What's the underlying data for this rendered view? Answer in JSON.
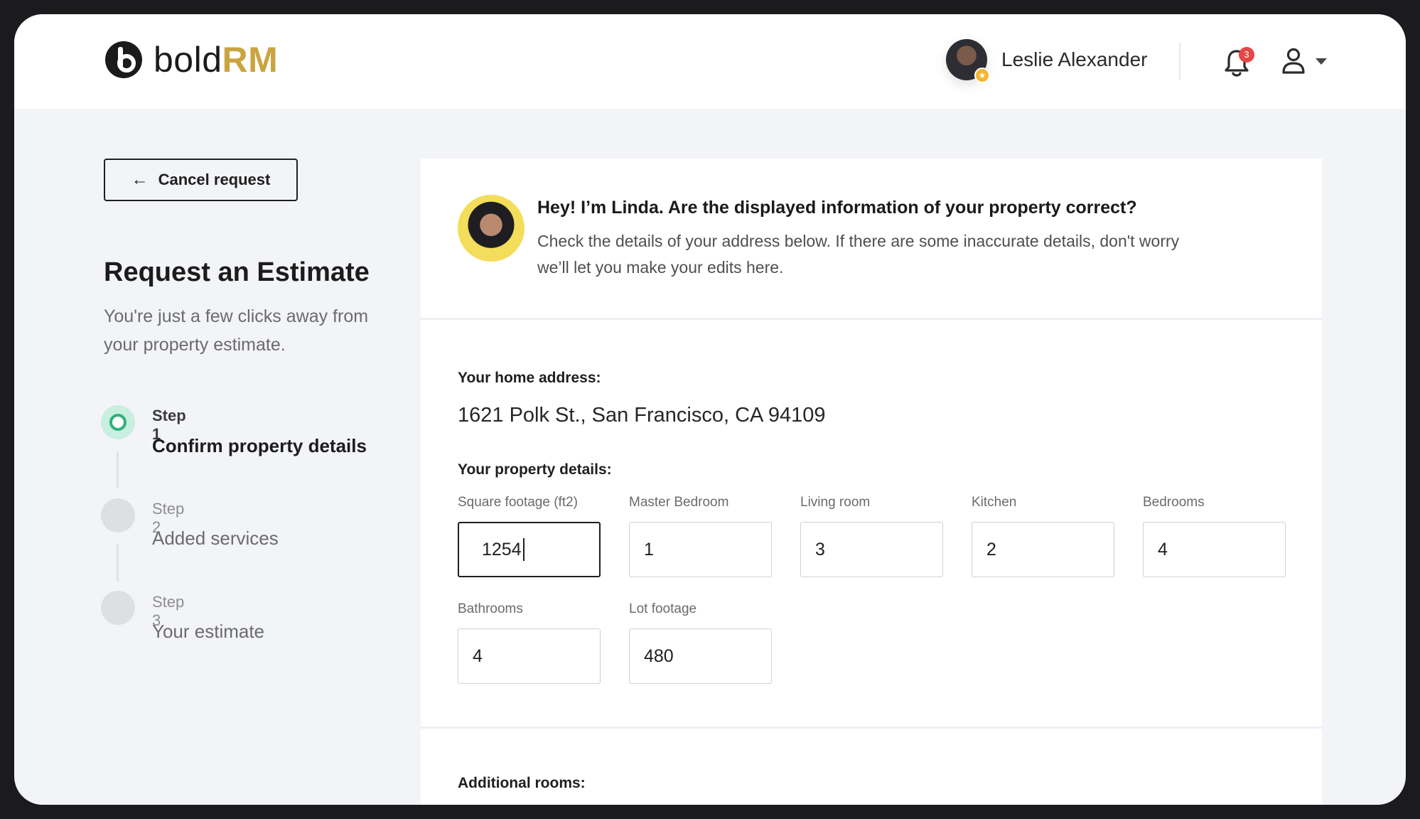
{
  "header": {
    "logo": {
      "text_main": "bold",
      "text_accent": "RM"
    },
    "user": {
      "name": "Leslie Alexander"
    },
    "notifications": {
      "count": "3"
    }
  },
  "sidebar": {
    "cancel_label": "Cancel request",
    "title": "Request an Estimate",
    "subtitle": "You're just a few clicks away from your property estimate.",
    "steps": [
      {
        "label": "Step 1",
        "title": "Confirm property details",
        "state": "active"
      },
      {
        "label": "Step 2",
        "title": "Added services",
        "state": "pending"
      },
      {
        "label": "Step 3",
        "title": "Your estimate",
        "state": "pending"
      }
    ]
  },
  "main": {
    "message": {
      "title": "Hey! I’m Linda. Are the displayed information of your property correct?",
      "body": "Check the details of your address below. If there are some inaccurate details, don't worry we’ll let you make your edits here."
    },
    "address_label": "Your home address:",
    "address": "1621 Polk St., San Francisco, CA 94109",
    "property_label": "Your property details:",
    "fields": [
      {
        "label": "Square footage (ft2)",
        "value": "1254"
      },
      {
        "label": "Master Bedroom",
        "value": "1"
      },
      {
        "label": "Living room",
        "value": "3"
      },
      {
        "label": "Kitchen",
        "value": "2"
      },
      {
        "label": "Bedrooms",
        "value": "4"
      },
      {
        "label": "Bathrooms",
        "value": "4"
      },
      {
        "label": "Lot footage",
        "value": "480"
      }
    ],
    "additional_label": "Additional rooms:"
  },
  "colors": {
    "accent_gold": "#c9a43f",
    "step_active": "#31b07e",
    "badge_red": "#e64646"
  },
  "icons": [
    "logo-mark-icon",
    "star-badge-icon",
    "bell-icon",
    "user-icon",
    "chevron-down-icon",
    "arrow-left-icon"
  ]
}
